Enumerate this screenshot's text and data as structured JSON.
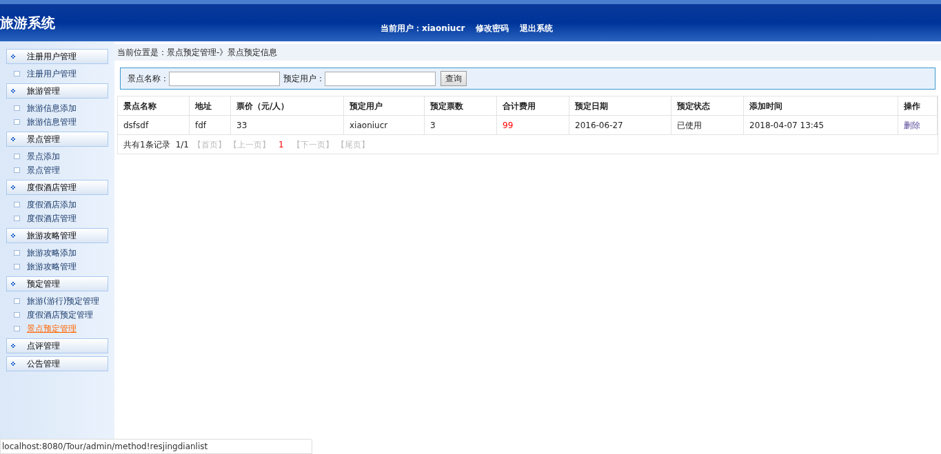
{
  "header": {
    "title": "旅游系统",
    "user_label": "当前用户：xiaoniucr",
    "links": [
      "修改密码",
      "退出系统"
    ]
  },
  "sidebar": {
    "groups": [
      {
        "label": "注册用户管理",
        "items": [
          {
            "label": "注册用户管理",
            "selected": false
          }
        ]
      },
      {
        "label": "旅游管理",
        "items": [
          {
            "label": "旅游信息添加",
            "selected": false
          },
          {
            "label": "旅游信息管理",
            "selected": false
          }
        ]
      },
      {
        "label": "景点管理",
        "items": [
          {
            "label": "景点添加",
            "selected": false
          },
          {
            "label": "景点管理",
            "selected": false
          }
        ]
      },
      {
        "label": "度假酒店管理",
        "items": [
          {
            "label": "度假酒店添加",
            "selected": false
          },
          {
            "label": "度假酒店管理",
            "selected": false
          }
        ]
      },
      {
        "label": "旅游攻略管理",
        "items": [
          {
            "label": "旅游攻略添加",
            "selected": false
          },
          {
            "label": "旅游攻略管理",
            "selected": false
          }
        ]
      },
      {
        "label": "预定管理",
        "items": [
          {
            "label": "旅游(游行)预定管理",
            "selected": false
          },
          {
            "label": "度假酒店预定管理",
            "selected": false
          },
          {
            "label": "景点预定管理",
            "selected": true
          }
        ]
      },
      {
        "label": "点评管理"
      },
      {
        "label": "公告管理"
      }
    ]
  },
  "breadcrumb": "当前位置是：景点预定管理-》景点预定信息",
  "search": {
    "fields": [
      {
        "label": "景点名称："
      },
      {
        "label": "预定用户："
      }
    ],
    "button": "查询"
  },
  "table": {
    "columns": [
      {
        "label": "景点名称",
        "kind": "text"
      },
      {
        "label": "地址",
        "kind": "text"
      },
      {
        "label": "票价（元/人）",
        "kind": "text"
      },
      {
        "label": "预定用户",
        "kind": "text"
      },
      {
        "label": "预定票数",
        "kind": "text"
      },
      {
        "label": "合计费用",
        "kind": "money"
      },
      {
        "label": "预定日期",
        "kind": "text"
      },
      {
        "label": "预定状态",
        "kind": "text"
      },
      {
        "label": "添加时间",
        "kind": "text"
      },
      {
        "label": "操作",
        "kind": "action"
      }
    ],
    "rows": [
      [
        "dsfsdf",
        "fdf",
        "33",
        "xiaoniucr",
        "3",
        "99",
        "2016-06-27",
        "已使用",
        "2018-04-07 13:45",
        "删除"
      ]
    ]
  },
  "pagination": {
    "summary": "共有1条记录",
    "pages": "1/1",
    "links": [
      {
        "label": "【首页】",
        "disabled": true,
        "selected": false
      },
      {
        "label": "【上一页】",
        "disabled": true,
        "selected": false
      },
      {
        "label": "1",
        "disabled": false,
        "selected": true
      },
      {
        "label": "【下一页】",
        "disabled": true,
        "selected": false
      },
      {
        "label": "【尾页】",
        "disabled": true,
        "selected": false
      }
    ]
  },
  "status_bar": "localhost:8080/Tour/admin/method!resjingdianlist"
}
